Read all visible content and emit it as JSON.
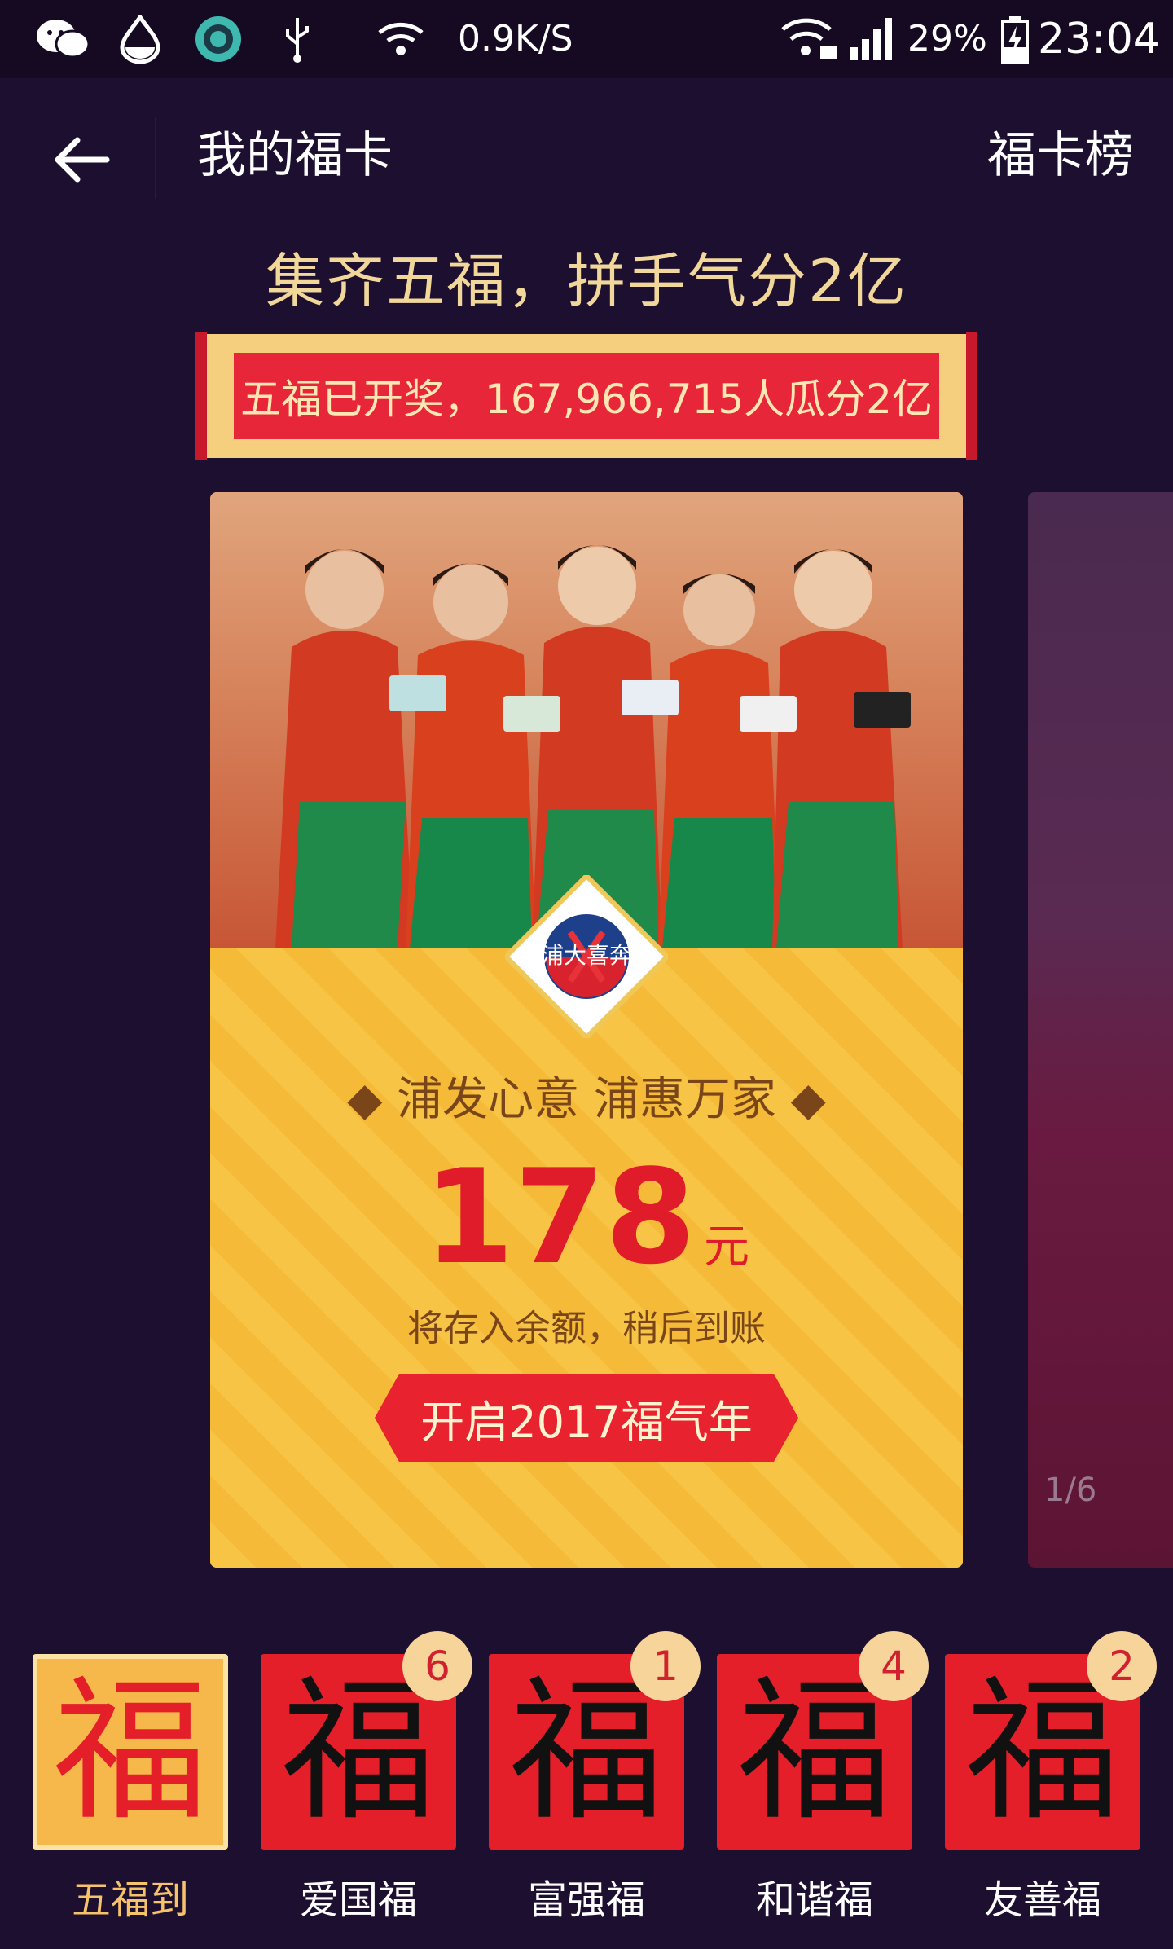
{
  "status_bar": {
    "speed": "0.9K/S",
    "battery": "29%",
    "time": "23:04",
    "icons": [
      "wechat-icon",
      "water-drop-icon",
      "camera-app-icon",
      "usb-icon",
      "wifi-icon",
      "wifi-lock-icon",
      "signal-icon",
      "battery-charging-icon"
    ]
  },
  "nav": {
    "title": "我的福卡",
    "right_link": "福卡榜"
  },
  "headline": "集齐五福，拼手气分2亿",
  "banner": "五福已开奖，167,966,715人瓜分2亿",
  "card": {
    "slogan": "浦发心意 浦惠万家",
    "amount": "178",
    "unit": "元",
    "note": "将存入余额，稍后到账",
    "cta": "开启2017福气年",
    "badge_text": "浦大喜奔"
  },
  "side_card": {
    "pager": "1/6"
  },
  "fu_cards": [
    {
      "label": "五福到",
      "glyph": "福",
      "count": "",
      "active": true
    },
    {
      "label": "爱国福",
      "glyph": "福",
      "count": "6",
      "active": false
    },
    {
      "label": "富强福",
      "glyph": "福",
      "count": "1",
      "active": false
    },
    {
      "label": "和谐福",
      "glyph": "福",
      "count": "4",
      "active": false
    },
    {
      "label": "友善福",
      "glyph": "福",
      "count": "2",
      "active": false
    }
  ],
  "colors": {
    "background": "#1c0f30",
    "gold_text": "#f2d79a",
    "red": "#e41f2a",
    "card_yellow": "#f5be3d"
  }
}
